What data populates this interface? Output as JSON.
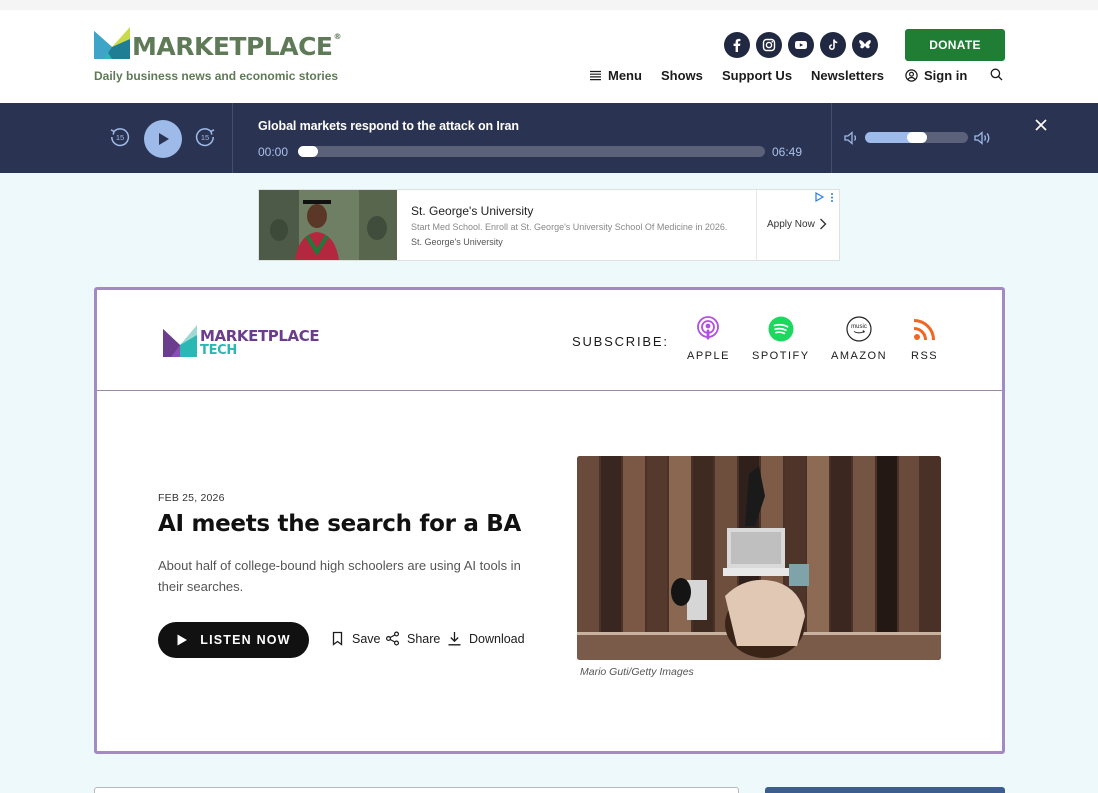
{
  "header": {
    "logo_text": "MARKETPLACE",
    "logo_reg": "®",
    "tagline": "Daily business news and economic stories",
    "social_icons": [
      "facebook-icon",
      "instagram-icon",
      "youtube-icon",
      "tiktok-icon",
      "bluesky-icon"
    ],
    "donate_label": "DONATE",
    "nav": {
      "menu": "Menu",
      "shows": "Shows",
      "support": "Support Us",
      "newsletters": "Newsletters",
      "signin": "Sign in"
    },
    "colors": {
      "brand_green": "#5f7a57",
      "donate": "#1f7d34"
    }
  },
  "player": {
    "title": "Global markets respond to the attack on Iran",
    "current_time": "00:00",
    "duration": "06:49",
    "skip_back": "15",
    "skip_forward": "15",
    "progress_fraction": 0.0,
    "volume_fraction": 0.5,
    "colors": {
      "bg": "#2b3352",
      "accent": "#9ebae8"
    }
  },
  "ad": {
    "title": "St. George's University",
    "description": "Start Med School. Enroll at St. George's University School Of Medicine in 2026.",
    "source": "St. George's University",
    "cta": "Apply Now"
  },
  "podcast": {
    "logo_line1": "MARKETPLACE",
    "logo_line2": "TECH",
    "subscribe_label": "SUBSCRIBE:",
    "subscribe": [
      {
        "label": "APPLE",
        "icon": "apple-podcasts-icon",
        "color": "#b150e2"
      },
      {
        "label": "SPOTIFY",
        "icon": "spotify-icon",
        "color": "#1ed760"
      },
      {
        "label": "AMAZON",
        "icon": "amazon-music-icon",
        "color": "#222222"
      },
      {
        "label": "RSS",
        "icon": "rss-icon",
        "color": "#f26522"
      }
    ],
    "episode": {
      "date": "FEB 25, 2026",
      "title": "AI meets the search for a BA",
      "description": "About half of college-bound high schoolers are using AI tools in their searches.",
      "listen_label": "LISTEN NOW",
      "save_label": "Save",
      "share_label": "Share",
      "download_label": "Download",
      "image_credit": "Mario Guti/Getty Images"
    },
    "colors": {
      "card_border": "#a48ac3"
    }
  }
}
